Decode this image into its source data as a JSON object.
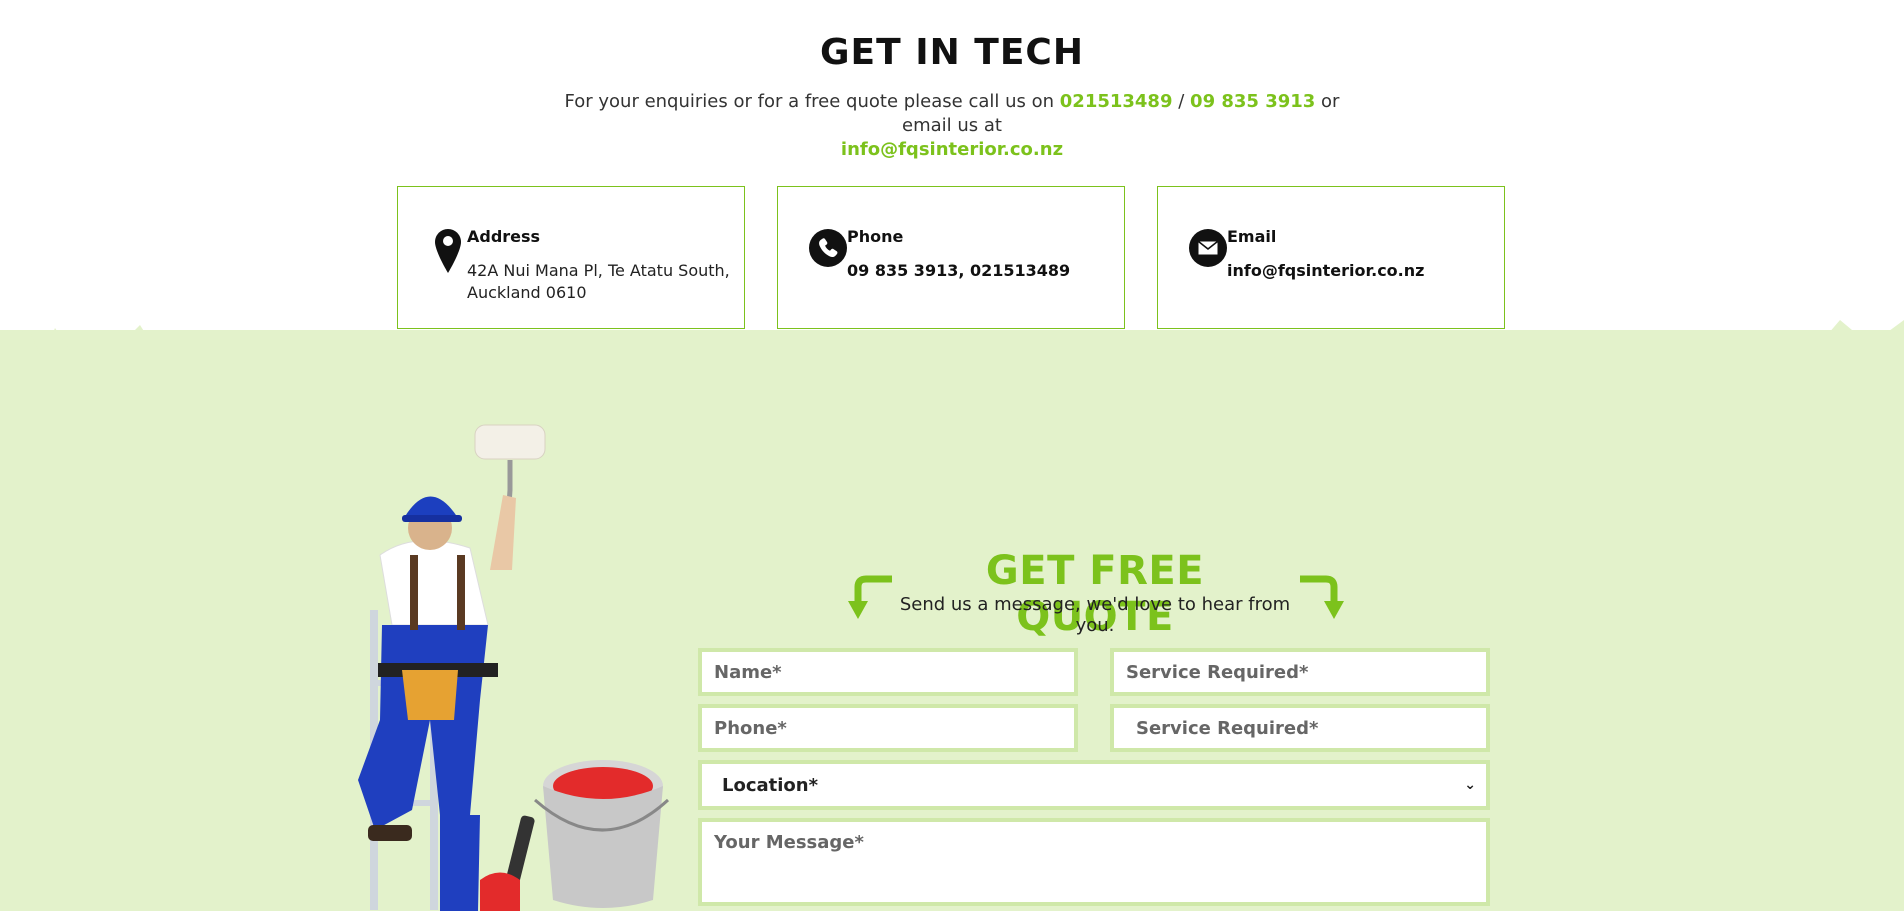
{
  "contact": {
    "title": "GET IN TECH",
    "intro_prefix": "For your enquiries or for a free quote please call us on",
    "phone1": "021513489",
    "separator": "/",
    "phone2": "09 835 3913",
    "intro_middle": "or email us at",
    "email": "info@fqsinterior.co.nz"
  },
  "cards": [
    {
      "icon": "location-pin-icon",
      "label": "Address",
      "value": "42A Nui Mana Pl, Te Atatu South, Auckland 0610"
    },
    {
      "icon": "phone-icon",
      "label": "Phone",
      "value": "09 835 3913, 021513489"
    },
    {
      "icon": "envelope-icon",
      "label": "Email",
      "value": "info@fqsinterior.co.nz"
    }
  ],
  "quote": {
    "title": "GET FREE QUOTE",
    "subtitle": "Send us a message, we'd love to hear from you.",
    "fields": {
      "name_placeholder": "Name*",
      "service_placeholder_1": "Service Required*",
      "phone_placeholder": "Phone*",
      "service_placeholder_2": "Service Required*",
      "location_selected": "Location*",
      "message_placeholder": "Your Message*"
    }
  },
  "colors": {
    "accent_green": "#7cc21c",
    "light_green_bg": "#e3f2cb",
    "field_border": "#cfe8a9",
    "worker_overalls": "#1f3fbf",
    "paint_red": "#e32b2b"
  }
}
